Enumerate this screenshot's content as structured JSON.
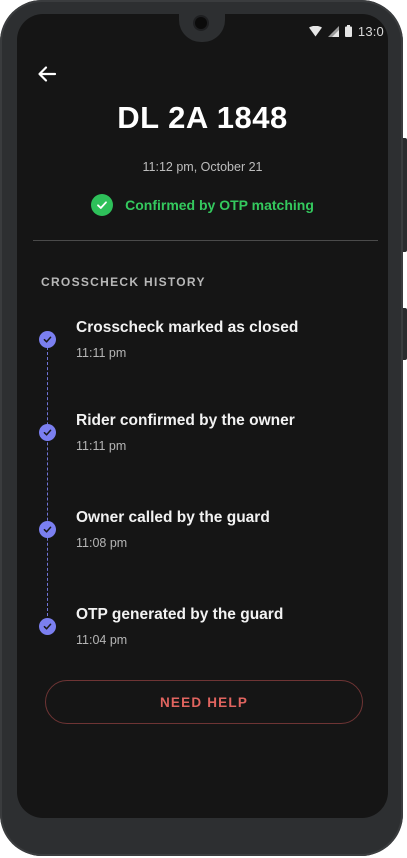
{
  "status_bar": {
    "time": "13:0",
    "icons": [
      "wifi-icon",
      "cellular-signal-icon",
      "battery-icon"
    ]
  },
  "header": {
    "back_icon": "arrow-left-icon"
  },
  "vehicle": {
    "plate_number": "DL 2A 1848",
    "timestamp": "11:12 pm, October 21",
    "confirmation_text": "Confirmed by OTP matching",
    "confirmation_icon": "check-circle-icon"
  },
  "history": {
    "section_title": "CROSSCHECK HISTORY",
    "items": [
      {
        "title": "Crosscheck marked as closed",
        "time": "11:11 pm"
      },
      {
        "title": "Rider confirmed by the owner",
        "time": "11:11 pm"
      },
      {
        "title": "Owner called by the guard",
        "time": "11:08 pm"
      },
      {
        "title": "OTP generated by the guard",
        "time": "11:04 pm"
      }
    ]
  },
  "actions": {
    "help_label": "NEED HELP"
  },
  "colors": {
    "background": "#151515",
    "success": "#34c95e",
    "timeline_accent": "#7b7ff0",
    "danger": "#e1645f"
  }
}
